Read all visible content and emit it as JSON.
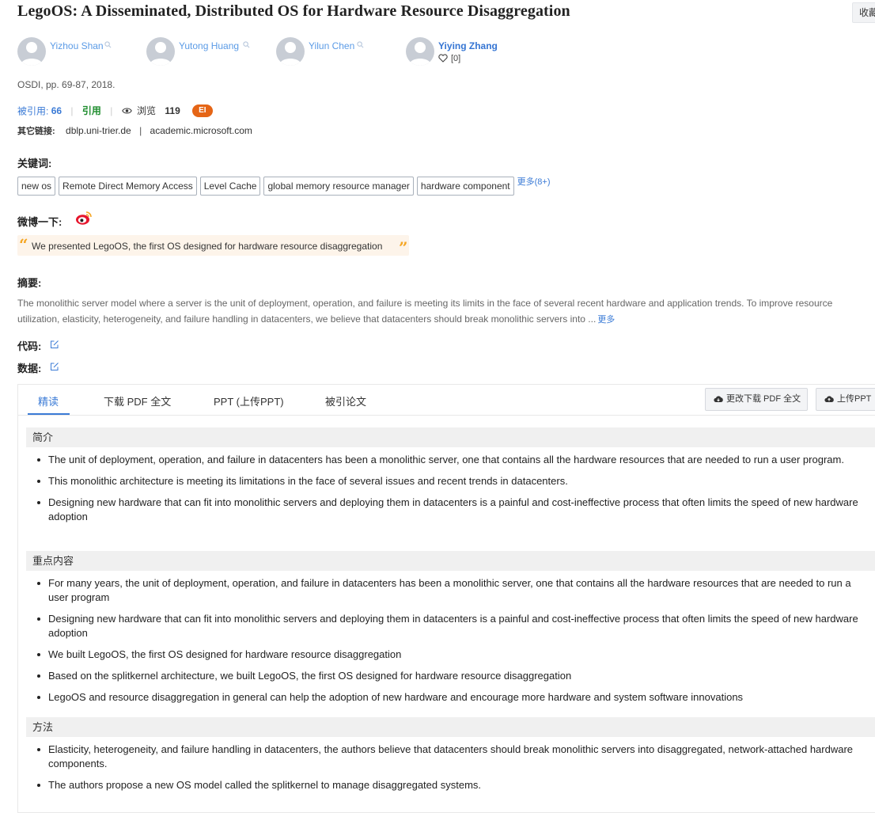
{
  "paper": {
    "title": "LegoOS: A Disseminated, Distributed OS for Hardware Resource Disaggregation",
    "favorite_label": "收藏",
    "venue": "OSDI, pp. 69-87, 2018."
  },
  "authors": [
    {
      "name": "Yizhou Shan"
    },
    {
      "name": "Yutong Huang"
    },
    {
      "name": "Yilun Chen"
    },
    {
      "name": "Yiying Zhang",
      "likes": "[0]"
    }
  ],
  "metrics": {
    "cited_label": "被引用:",
    "cited_count": "66",
    "cite_label": "引用",
    "views_label": "浏览",
    "views_count": "119",
    "badge": "EI"
  },
  "other_links": {
    "label": "其它链接:",
    "links": [
      "dblp.uni-trier.de",
      "academic.microsoft.com"
    ]
  },
  "keywords": {
    "label": "关键词:",
    "items": [
      "new os",
      "Remote Direct Memory Access",
      "Level Cache",
      "global memory resource manager",
      "hardware component"
    ],
    "more": "更多(8+)"
  },
  "weibo": {
    "label": "微博一下:",
    "quote": "We presented LegoOS, the first OS designed for hardware resource disaggregation"
  },
  "abstract": {
    "label": "摘要:",
    "text": "The monolithic server model where a server is the unit of deployment, operation, and failure is meeting its limits in the face of several recent hardware and application trends. To improve resource utilization, elasticity, heterogeneity, and failure handling in datacenters, we believe that datacenters should break monolithic servers into ...",
    "more": "更多"
  },
  "code_label": "代码:",
  "data_label": "数据:",
  "tabs": {
    "items": [
      "精读",
      "下载 PDF 全文",
      "PPT (上传PPT)",
      "被引论文"
    ],
    "btn_download": "更改下载 PDF 全文",
    "btn_upload": "上传PPT"
  },
  "sections": [
    {
      "heading": "简介",
      "bullets": [
        "The unit of deployment, operation, and failure in datacenters has been a monolithic server, one that contains all the hardware resources that are needed to run a user program.",
        "This monolithic architecture is meeting its limitations in the face of several issues and recent trends in datacenters.",
        "Designing new hardware that can fit into monolithic servers and deploying them in datacenters is a painful and cost-ineffective process that often limits the speed of new hardware adoption"
      ]
    },
    {
      "heading": "重点内容",
      "bullets": [
        "For many years, the unit of deployment, operation, and failure in datacenters has been a monolithic server, one that contains all the hardware resources that are needed to run a user program",
        "Designing new hardware that can fit into monolithic servers and deploying them in datacenters is a painful and cost-ineffective process that often limits the speed of new hardware adoption",
        "We built LegoOS, the first OS designed for hardware resource disaggregation",
        "Based on the splitkernel architecture, we built LegoOS, the first OS designed for hardware resource disaggregation",
        "LegoOS and resource disaggregation in general can help the adoption of new hardware and encourage more hardware and system software innovations"
      ]
    },
    {
      "heading": "方法",
      "bullets": [
        "Elasticity, heterogeneity, and failure handling in datacenters, the authors believe that datacenters should break monolithic servers into disaggregated, network-attached hardware components.",
        "The authors propose a new OS model called the splitkernel to manage disaggregated systems."
      ]
    }
  ]
}
